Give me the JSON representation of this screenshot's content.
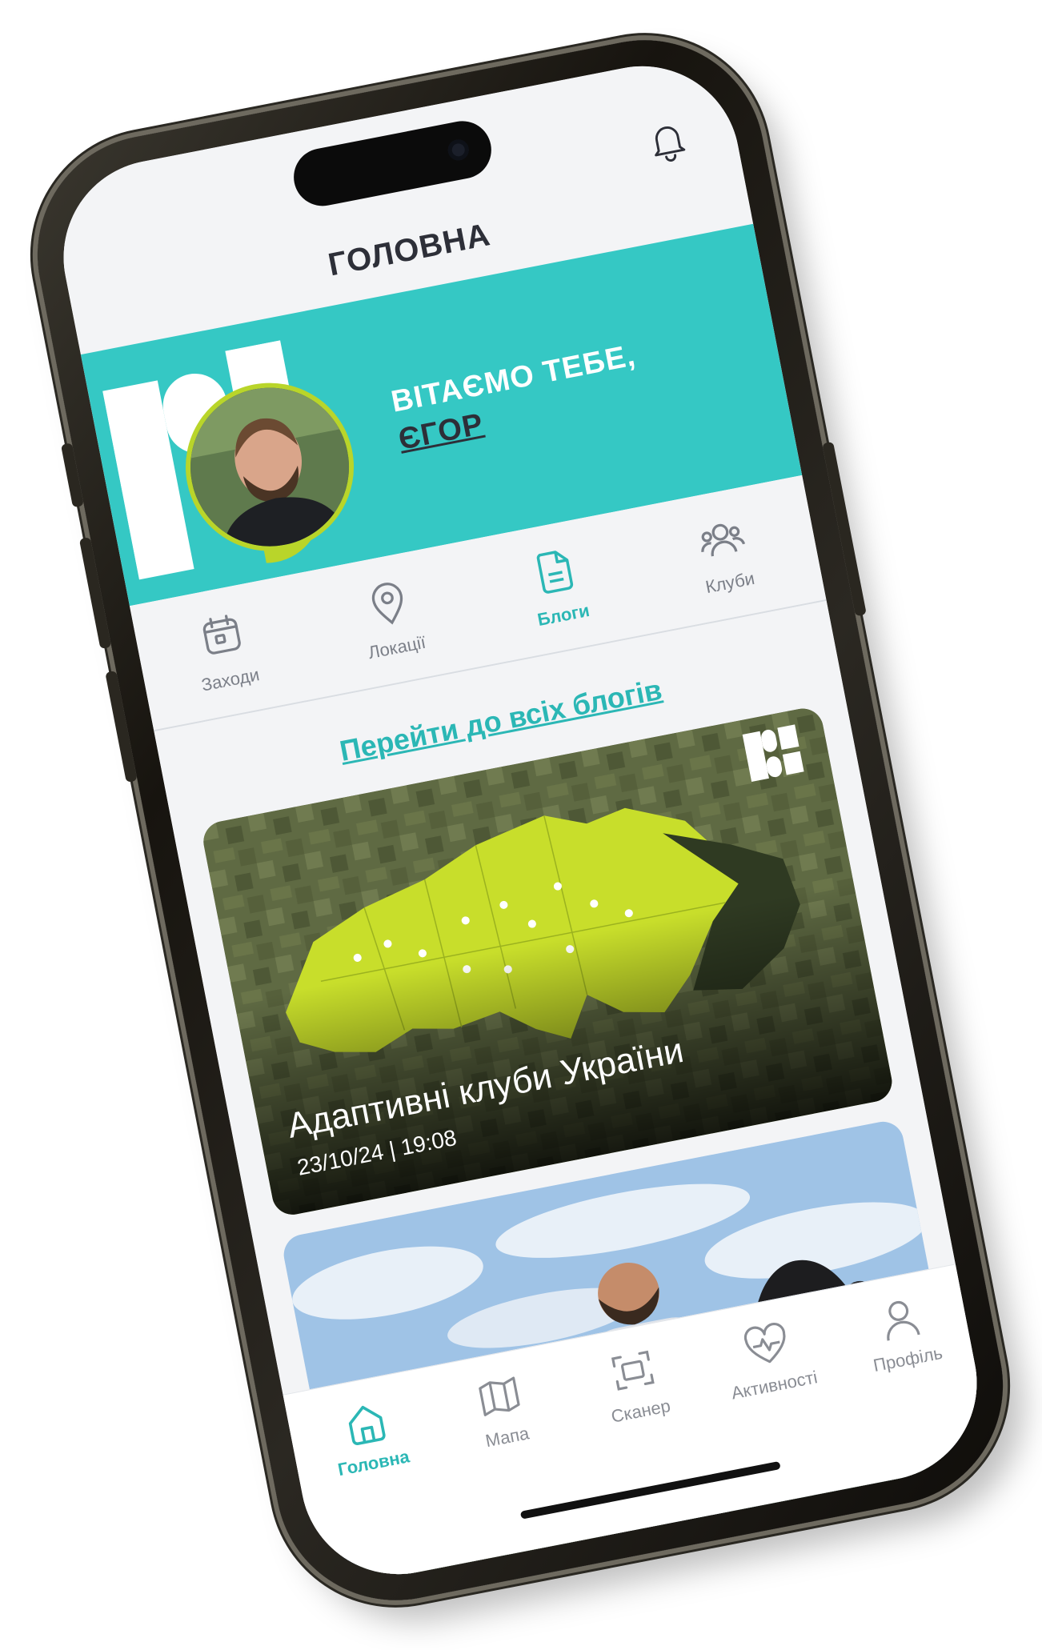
{
  "header": {
    "title": "ГОЛОВНА",
    "bell_icon": "bell-icon"
  },
  "hero": {
    "greeting": "ВІТАЄМО ТЕБЕ,",
    "name": "ЄГОР",
    "background_color": "#35c8c4",
    "accent_color": "#b9d52a"
  },
  "tabs": [
    {
      "label": "Заходи",
      "icon": "calendar-icon",
      "active": false
    },
    {
      "label": "Локації",
      "icon": "location-pin-icon",
      "active": false
    },
    {
      "label": "Блоги",
      "icon": "document-icon",
      "active": true
    },
    {
      "label": "Клуби",
      "icon": "group-icon",
      "active": false
    }
  ],
  "blogs": {
    "all_link": "Перейти до всіх блогів",
    "cards": [
      {
        "title": "Адаптивні клуби України",
        "date": "23/10/24 | 19:08"
      }
    ]
  },
  "nav": [
    {
      "label": "Головна",
      "icon": "home-icon",
      "active": true
    },
    {
      "label": "Мапа",
      "icon": "map-icon",
      "active": false
    },
    {
      "label": "Сканер",
      "icon": "scanner-icon",
      "active": false
    },
    {
      "label": "Активності",
      "icon": "heart-pulse-icon",
      "active": false
    },
    {
      "label": "Профіль",
      "icon": "user-icon",
      "active": false
    }
  ],
  "colors": {
    "accent": "#2bb7b5",
    "text_dark": "#2d2f38",
    "muted": "#7b7f88"
  }
}
